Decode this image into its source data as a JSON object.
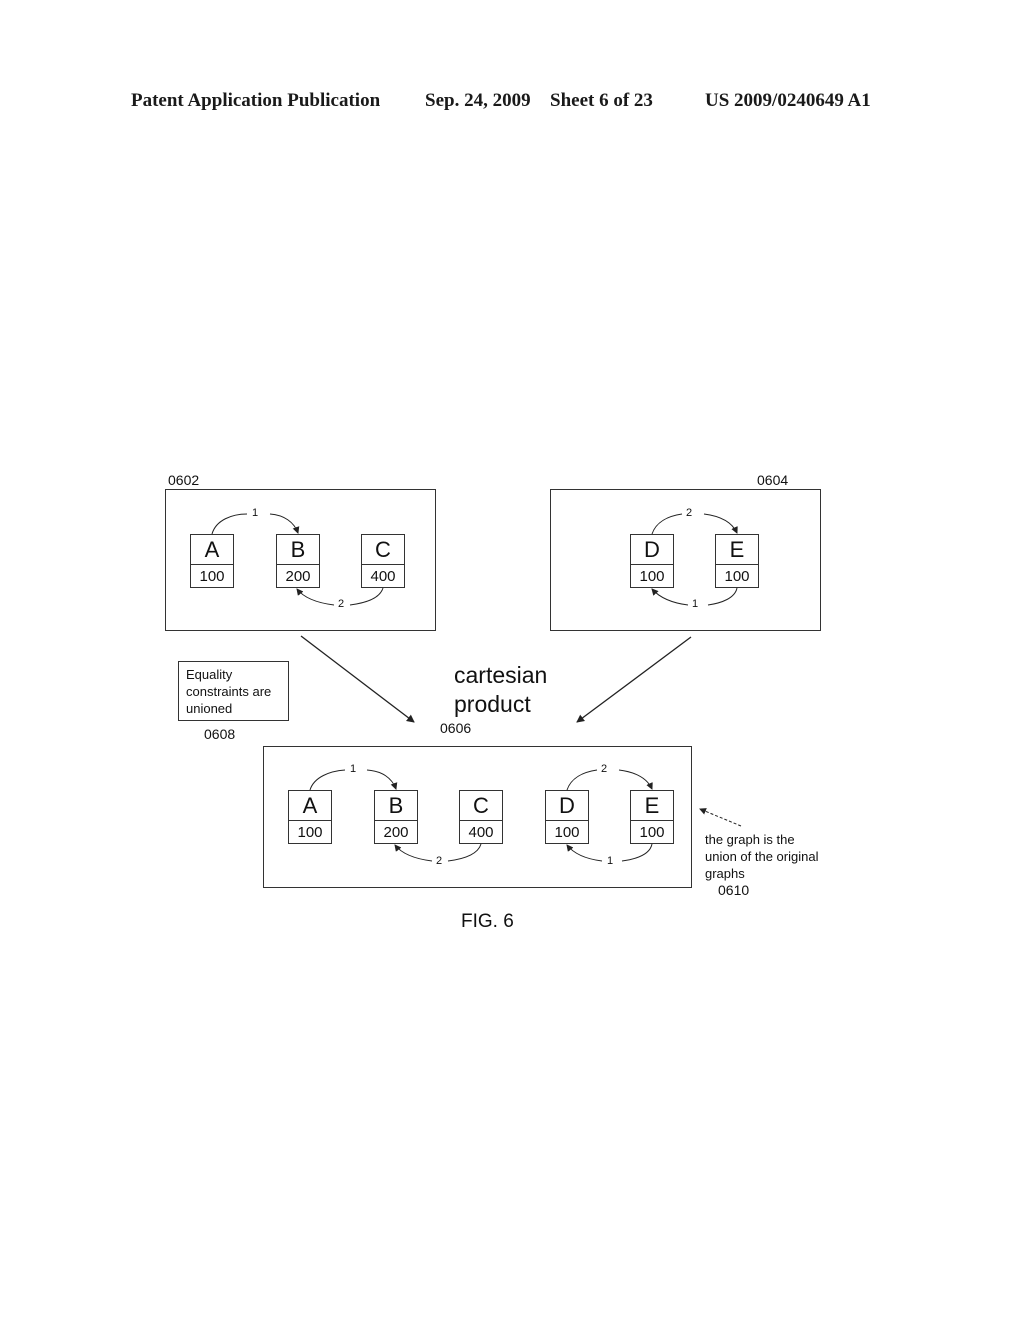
{
  "header": {
    "publication": "Patent Application Publication",
    "date": "Sep. 24, 2009",
    "sheet": "Sheet 6 of 23",
    "number": "US 2009/0240649 A1"
  },
  "graphs": {
    "g0602": {
      "ref": "0602",
      "nodes": [
        {
          "id": "A",
          "value": "100"
        },
        {
          "id": "B",
          "value": "200"
        },
        {
          "id": "C",
          "value": "400"
        }
      ],
      "edges": [
        {
          "from": "A",
          "to": "B",
          "label": "1"
        },
        {
          "from": "C",
          "to": "B",
          "label": "2"
        }
      ]
    },
    "g0604": {
      "ref": "0604",
      "nodes": [
        {
          "id": "D",
          "value": "100"
        },
        {
          "id": "E",
          "value": "100"
        }
      ],
      "edges": [
        {
          "from": "D",
          "to": "E",
          "label": "2"
        },
        {
          "from": "E",
          "to": "D",
          "label": "1"
        }
      ]
    },
    "g0606": {
      "ref": "0606",
      "nodes": [
        {
          "id": "A",
          "value": "100"
        },
        {
          "id": "B",
          "value": "200"
        },
        {
          "id": "C",
          "value": "400"
        },
        {
          "id": "D",
          "value": "100"
        },
        {
          "id": "E",
          "value": "100"
        }
      ],
      "edges": [
        {
          "from": "A",
          "to": "B",
          "label": "1"
        },
        {
          "from": "C",
          "to": "B",
          "label": "2"
        },
        {
          "from": "D",
          "to": "E",
          "label": "2"
        },
        {
          "from": "E",
          "to": "D",
          "label": "1"
        }
      ]
    }
  },
  "operation": {
    "line1": "cartesian",
    "line2": "product"
  },
  "note0608": {
    "lines": [
      "Equality",
      "constraints are",
      "unioned"
    ],
    "ref": "0608"
  },
  "note0610": {
    "lines": [
      "the graph is the",
      "union of the original",
      "graphs"
    ],
    "ref": "0610"
  },
  "caption": "FIG. 6"
}
